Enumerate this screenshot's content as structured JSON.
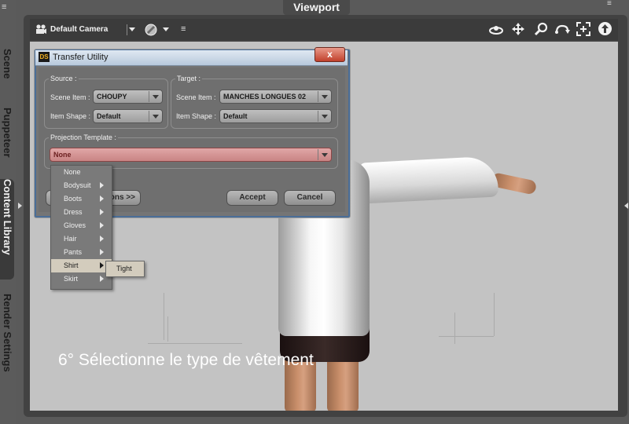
{
  "left_dock": {
    "tabs": [
      {
        "label": "Scene"
      },
      {
        "label": "Puppeteer"
      },
      {
        "label": "Content Library"
      },
      {
        "label": "Render Settings"
      }
    ]
  },
  "viewport": {
    "tab_label": "Viewport",
    "camera_label": "Default Camera",
    "toolbar_icons": [
      "orbit-icon",
      "pan-icon",
      "zoom-icon",
      "rotate-icon",
      "frame-icon",
      "home-icon"
    ]
  },
  "dialog": {
    "title": "Transfer Utility",
    "icon_text": "DS",
    "close_label": "x",
    "source": {
      "group_label": "Source :",
      "scene_item_label": "Scene Item :",
      "scene_item_value": "CHOUPY",
      "item_shape_label": "Item Shape :",
      "item_shape_value": "Default"
    },
    "target": {
      "group_label": "Target :",
      "scene_item_label": "Scene Item :",
      "scene_item_value": "MANCHES LONGUES 02",
      "item_shape_label": "Item Shape :",
      "item_shape_value": "Default"
    },
    "projection": {
      "group_label": "Projection Template :",
      "value": "None"
    },
    "options_label": "ions >>",
    "accept_label": "Accept",
    "cancel_label": "Cancel"
  },
  "menu": {
    "items": [
      {
        "label": "None",
        "has_submenu": false
      },
      {
        "label": "Bodysuit",
        "has_submenu": true
      },
      {
        "label": "Boots",
        "has_submenu": true
      },
      {
        "label": "Dress",
        "has_submenu": true
      },
      {
        "label": "Gloves",
        "has_submenu": true
      },
      {
        "label": "Hair",
        "has_submenu": true
      },
      {
        "label": "Pants",
        "has_submenu": true
      },
      {
        "label": "Shirt",
        "has_submenu": true,
        "selected": true
      },
      {
        "label": "Skirt",
        "has_submenu": true
      }
    ],
    "submenu_item": "Tight"
  },
  "caption": "6°   Sélectionne le type de vêtement",
  "colors": {
    "accent_red": "#c98585",
    "menu_highlight": "#d3ccbd",
    "scene_bg": "#c3c3c3"
  }
}
